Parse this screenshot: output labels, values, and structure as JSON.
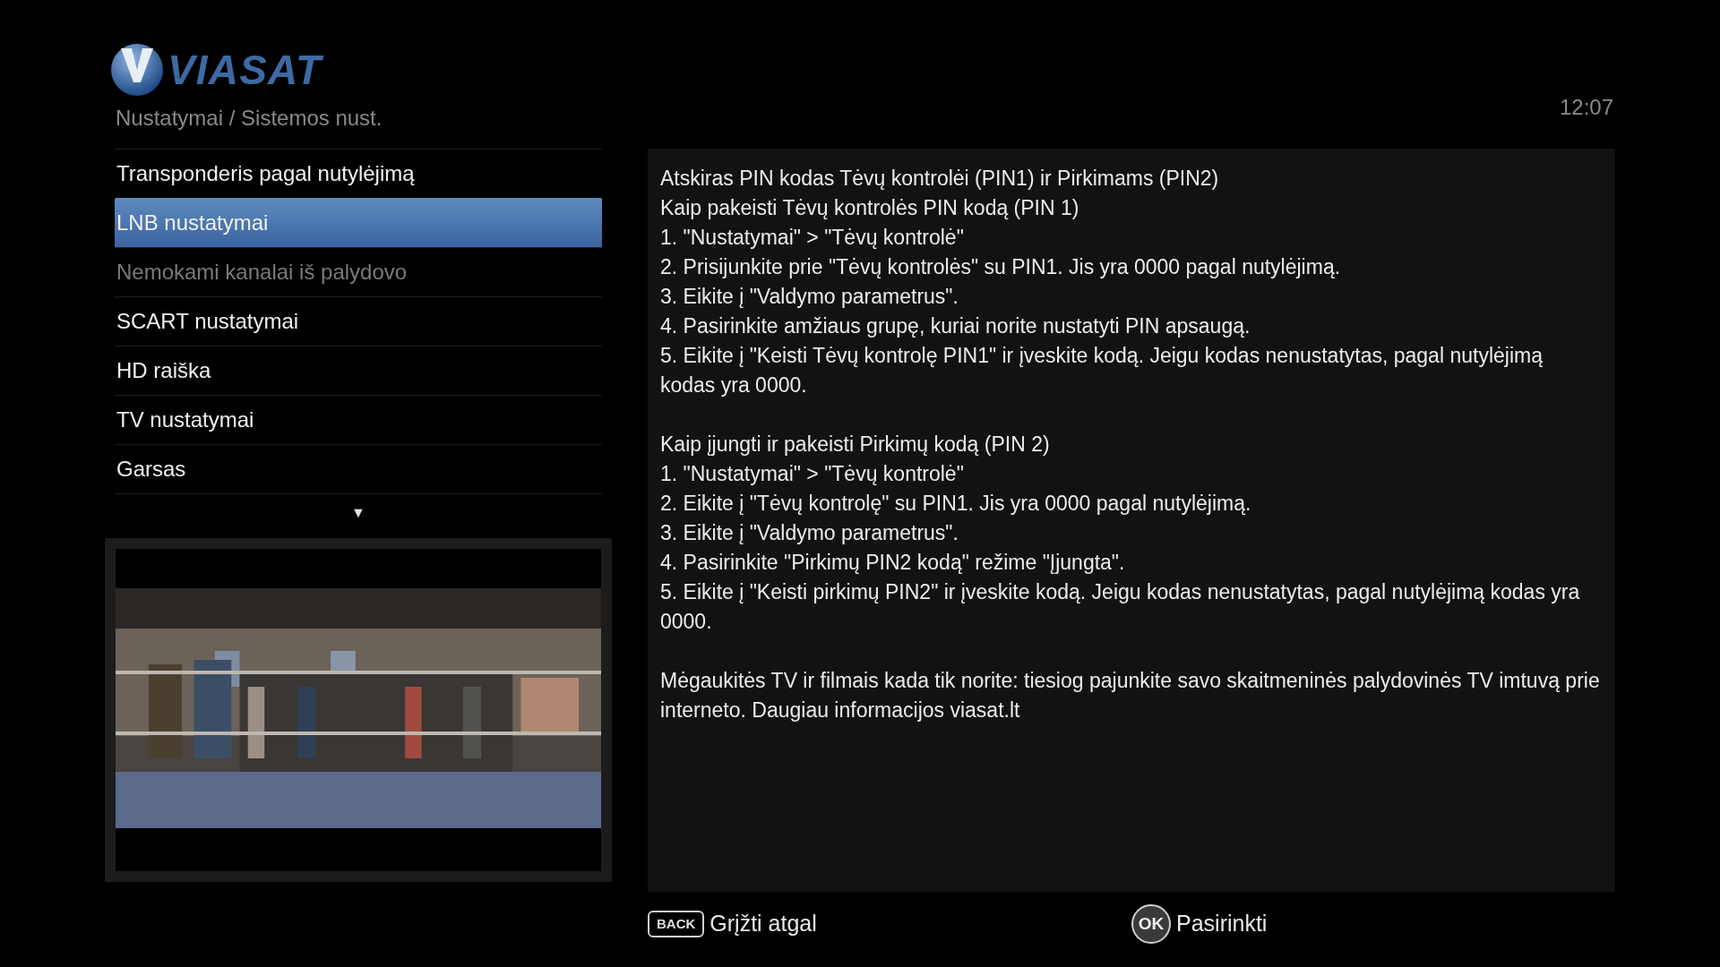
{
  "header": {
    "logo_text": "VIASAT",
    "breadcrumb": "Nustatymai / Sistemos nust.",
    "time": "12:07"
  },
  "menu": {
    "items": [
      {
        "label": "Transponderis pagal nutylėjimą",
        "selected": false,
        "disabled": false
      },
      {
        "label": "LNB nustatymai",
        "selected": true,
        "disabled": false
      },
      {
        "label": "Nemokami kanalai iš palydovo",
        "selected": false,
        "disabled": true
      },
      {
        "label": "SCART nustatymai",
        "selected": false,
        "disabled": false
      },
      {
        "label": "HD raiška",
        "selected": false,
        "disabled": false
      },
      {
        "label": "TV nustatymai",
        "selected": false,
        "disabled": false
      },
      {
        "label": "Garsas",
        "selected": false,
        "disabled": false
      }
    ],
    "more_indicator": "▼"
  },
  "info": {
    "sections": [
      {
        "lines": [
          "Atskiras PIN kodas Tėvų kontrolėi (PIN1) ir Pirkimams (PIN2)",
          "Kaip pakeisti Tėvų kontrolės PIN kodą (PIN 1)",
          "1. \"Nustatymai\" > \"Tėvų kontrolė\"",
          "2. Prisijunkite prie \"Tėvų kontrolės\" su PIN1. Jis yra 0000 pagal nutylėjimą.",
          "3. Eikite į \"Valdymo parametrus\".",
          "4. Pasirinkite amžiaus grupę, kuriai norite nustatyti PIN apsaugą.",
          "5. Eikite į \"Keisti Tėvų kontrolę PIN1\" ir įveskite kodą.  Jeigu kodas nenustatytas, pagal nutylėjimą kodas yra 0000."
        ]
      },
      {
        "lines": [
          "Kaip įjungti ir pakeisti Pirkimų kodą (PIN 2)",
          "1. \"Nustatymai\" > \"Tėvų kontrolė\"",
          "2. Eikite į \"Tėvų kontrolę\" su PIN1. Jis yra 0000 pagal nutylėjimą.",
          "3. Eikite į \"Valdymo parametrus\".",
          "4. Pasirinkite \"Pirkimų PIN2 kodą\" režime \"Įjungta\".",
          "5. Eikite į \"Keisti pirkimų PIN2\" ir įveskite kodą. Jeigu kodas nenustatytas, pagal nutylėjimą kodas yra 0000."
        ]
      },
      {
        "lines": [
          "Mėgaukitės TV ir filmais kada tik norite: tiesiog pajunkite savo skaitmeninės palydovinės TV imtuvą prie interneto. Daugiau informacijos  viasat.lt"
        ]
      }
    ]
  },
  "footer": {
    "hints": [
      {
        "kind": "back",
        "key": "BACK",
        "label": "Grįžti atgal"
      },
      {
        "kind": "ok",
        "key": "OK",
        "label": "Pasirinkti"
      }
    ]
  }
}
